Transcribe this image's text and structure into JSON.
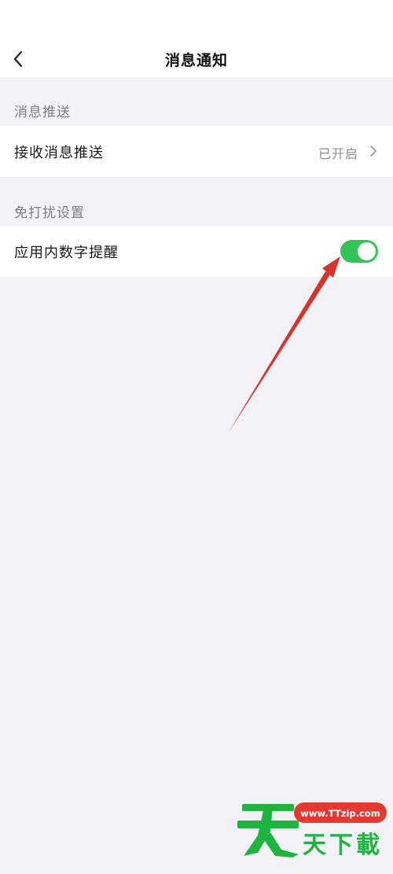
{
  "header": {
    "title": "消息通知",
    "back_icon": "chevron-left-icon"
  },
  "sections": [
    {
      "title": "消息推送",
      "rows": [
        {
          "label": "接收消息推送",
          "value": "已开启",
          "icon": "chevron-right-icon"
        }
      ]
    },
    {
      "title": "免打扰设置",
      "rows": [
        {
          "label": "应用内数字提醒",
          "toggle_state": "on"
        }
      ]
    }
  ],
  "colors": {
    "toggle_on": "#34c359",
    "background": "#f2f2f7",
    "annotation": "#d8322c"
  },
  "watermark": {
    "url": "www.TTzip.com",
    "name": "天天下載"
  }
}
